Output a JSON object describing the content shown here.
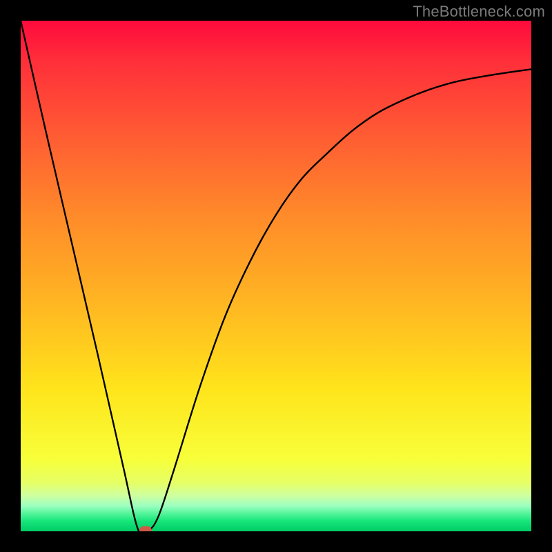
{
  "watermark": "TheBottleneck.com",
  "colors": {
    "frame": "#000000",
    "curve": "#000000",
    "marker": "#d05a48",
    "watermark_text": "#7a7a7a"
  },
  "chart_data": {
    "type": "line",
    "title": "",
    "xlabel": "",
    "ylabel": "",
    "xlim": [
      0,
      100
    ],
    "ylim": [
      0,
      100
    ],
    "x": [
      0,
      5,
      10,
      15,
      20,
      23,
      25,
      27,
      30,
      35,
      40,
      45,
      50,
      55,
      60,
      65,
      70,
      75,
      80,
      85,
      90,
      95,
      100
    ],
    "y": [
      100,
      78,
      56.5,
      35,
      13,
      0.3,
      0.1,
      3,
      12,
      28,
      42,
      53,
      62,
      69,
      74,
      78.5,
      82,
      84.5,
      86.5,
      88,
      89,
      89.8,
      90.5
    ],
    "marker": {
      "x": 24.5,
      "y": 0.1
    }
  }
}
